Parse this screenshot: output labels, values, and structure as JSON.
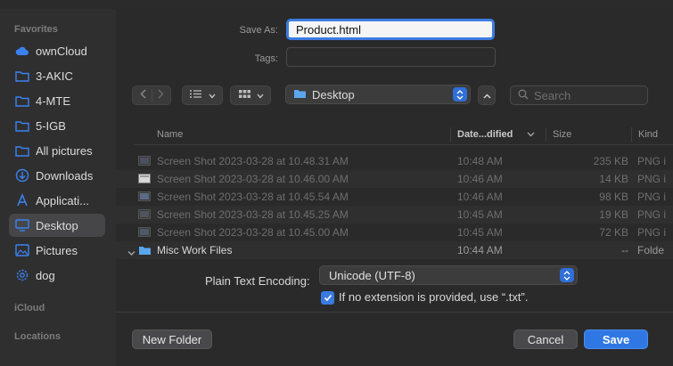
{
  "sidebar": {
    "favorites_header": "Favorites",
    "items": [
      {
        "label": "ownCloud",
        "icon": "cloud-icon"
      },
      {
        "label": "3-AKIC",
        "icon": "folder-icon"
      },
      {
        "label": "4-MTE",
        "icon": "folder-icon"
      },
      {
        "label": "5-IGB",
        "icon": "folder-icon"
      },
      {
        "label": "All pictures",
        "icon": "folder-icon"
      },
      {
        "label": "Downloads",
        "icon": "download-icon"
      },
      {
        "label": "Applicati...",
        "icon": "applications-icon"
      },
      {
        "label": "Desktop",
        "icon": "desktop-icon",
        "selected": true
      },
      {
        "label": "Pictures",
        "icon": "pictures-icon"
      },
      {
        "label": "dog",
        "icon": "gear-icon"
      }
    ],
    "icloud_header": "iCloud",
    "locations_header": "Locations"
  },
  "form": {
    "save_as_label": "Save As:",
    "save_as_value": "Product.html",
    "tags_label": "Tags:"
  },
  "toolbar": {
    "location": "Desktop",
    "search_placeholder": "Search"
  },
  "columns": {
    "name": "Name",
    "date": "Date...dified",
    "size": "Size",
    "kind": "Kind"
  },
  "files": [
    {
      "name": "Screen Shot 2023-03-28 at 10.48.31 AM",
      "date": "10:48 AM",
      "size": "235 KB",
      "kind": "PNG i"
    },
    {
      "name": "Screen Shot 2023-03-28 at 10.46.00 AM",
      "date": "10:46 AM",
      "size": "14 KB",
      "kind": "PNG i"
    },
    {
      "name": "Screen Shot 2023-03-28 at 10.45.54 AM",
      "date": "10:46 AM",
      "size": "98 KB",
      "kind": "PNG i"
    },
    {
      "name": "Screen Shot 2023-03-28 at 10.45.25 AM",
      "date": "10:45 AM",
      "size": "19 KB",
      "kind": "PNG i"
    },
    {
      "name": "Screen Shot 2023-03-28 at 10.45.00 AM",
      "date": "10:45 AM",
      "size": "72 KB",
      "kind": "PNG i"
    },
    {
      "name": "Misc Work Files",
      "date": "10:44 AM",
      "size": "--",
      "kind": "Folde"
    }
  ],
  "options": {
    "encoding_label": "Plain Text Encoding:",
    "encoding_value": "Unicode (UTF-8)",
    "checkbox_label": "If no extension is provided, use “.txt”.",
    "checkbox_checked": true
  },
  "buttons": {
    "new_folder": "New Folder",
    "cancel": "Cancel",
    "save": "Save"
  },
  "colors": {
    "accent": "#2f78e4",
    "background": "#2a2a2b",
    "sidebar": "#2f2f30"
  }
}
